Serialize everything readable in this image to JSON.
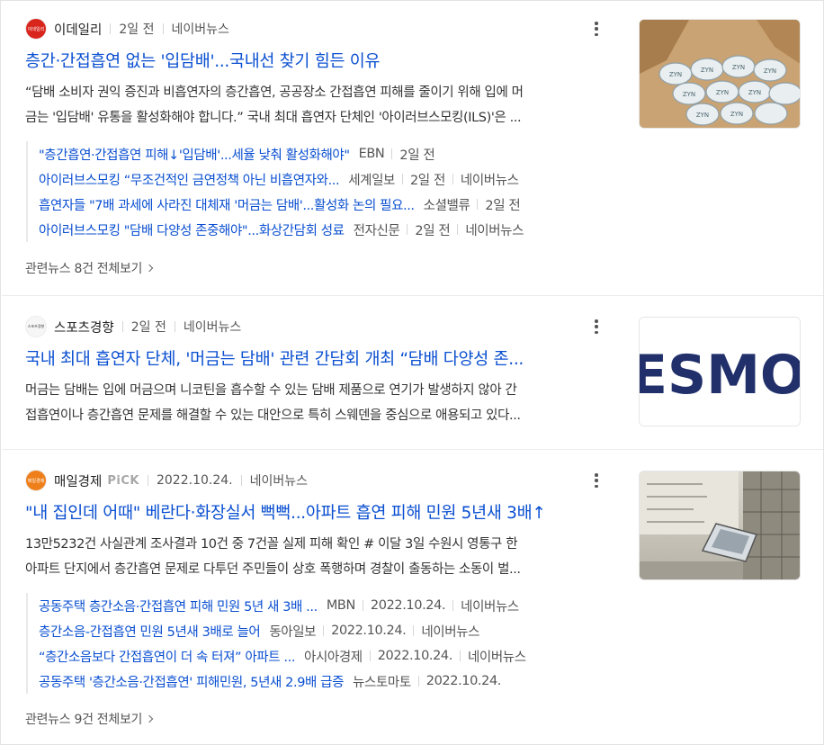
{
  "articles": [
    {
      "press": "이데일리",
      "logo_text": "이데일리",
      "time": "2일 전",
      "portal": "네이버뉴스",
      "title": "층간·간접흡연 없는 '입담배'...국내선 찾기 힘든 이유",
      "desc_line1": "“담배 소비자 권익 증진과 비흡연자의 층간흡연, 공공장소 간접흡연 피해를 줄이기 위해 입에 머",
      "desc_line2": "금는 '입담배' 유통을 활성화해야 합니다.” 국내 최대 흡연자 단체인 '아이러브스모킹(ILS)'은 ...",
      "thumb_alt": "snus-tins-in-box",
      "related": [
        {
          "title": "\"층간흡연·간접흡연 피해↓'입담배'...세율 낮춰 활성화해야\"",
          "press": "EBN",
          "time": "2일 전",
          "portal": ""
        },
        {
          "title": "아이러브스모킹 “무조건적인 금연정책 아닌 비흡연자와...",
          "press": "세계일보",
          "time": "2일 전",
          "portal": "네이버뉴스"
        },
        {
          "title": "흡연자들 \"7배 과세에 사라진 대체재 '머금는 담배'...활성화 논의 필요...",
          "press": "소셜밸류",
          "time": "2일 전",
          "portal": ""
        },
        {
          "title": "아이러브스모킹 \"담배 다양성 존중해야\"...화상간담회 성료",
          "press": "전자신문",
          "time": "2일 전",
          "portal": "네이버뉴스"
        }
      ],
      "related_all": "관련뉴스 8건 전체보기"
    },
    {
      "press": "스포츠경향",
      "logo_text": "스포츠경향",
      "time": "2일 전",
      "portal": "네이버뉴스",
      "title": "국내 최대 흡연자 단체, '머금는 담배' 관련 간담회 개최 “담배 다양성 존...",
      "desc_line1": "머금는 담배는 입에 머금으며 니코틴을 흡수할 수 있는 담배 제품으로 연기가 발생하지 않아 간",
      "desc_line2": "접흡연이나 층간흡연 문제를 해결할 수 있는 대안으로 특히 스웨덴을 중심으로 애용되고 있다...",
      "thumb_text": "ESMOI"
    },
    {
      "press": "매일경제",
      "pick": "PiCK",
      "logo_text": "매일경제",
      "time": "2022.10.24.",
      "portal": "네이버뉴스",
      "title": "\"내 집인데 어때\" 베란다·화장실서 뻑뻑...아파트 흡연 피해 민원 5년새 3배↑",
      "desc_line1": "13만5232건 사실관계 조사결과 10건 중 7건꼴 실제 피해 확인 # 이달 3일 수원시 영통구 한",
      "desc_line2": "아파트 단지에서 층간흡연 문제로 다투던 주민들이 상호 폭행하며 경찰이 출동하는 소동이 벌...",
      "thumb_alt": "apartment-smoking-ashtray",
      "related": [
        {
          "title": "공동주택 층간소음·간접흡연 피해 민원 5년 새 3배 ...",
          "press": "MBN",
          "time": "2022.10.24.",
          "portal": "네이버뉴스"
        },
        {
          "title": "층간소음-간접흡연 민원 5년새 3배로 늘어",
          "press": "동아일보",
          "time": "2022.10.24.",
          "portal": "네이버뉴스"
        },
        {
          "title": "“층간소음보다 간접흡연이 더 속 터져” 아파트 ...",
          "press": "아시아경제",
          "time": "2022.10.24.",
          "portal": "네이버뉴스"
        },
        {
          "title": "공동주택 '층간소음·간접흡연' 피해민원, 5년새 2.9배 급증",
          "press": "뉴스토마토",
          "time": "2022.10.24.",
          "portal": ""
        }
      ],
      "related_all": "관련뉴스 9건 전체보기"
    }
  ],
  "colors": {
    "link": "#0a4fd1",
    "meta": "#555555",
    "divider": "#ebebeb"
  }
}
